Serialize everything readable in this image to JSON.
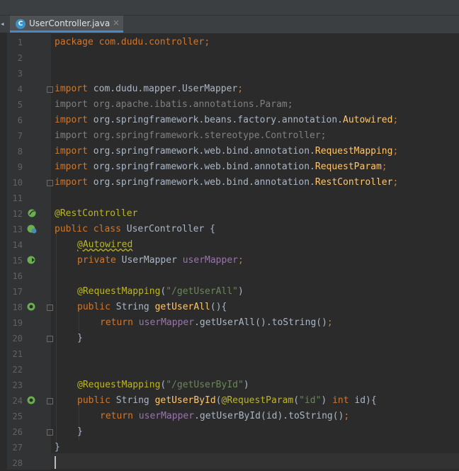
{
  "tab": {
    "icon_letter": "C",
    "label": "UserController.java",
    "close_symbol": "×",
    "left_arrow": "◂"
  },
  "line_numbers": [
    "1",
    "2",
    "3",
    "4",
    "5",
    "6",
    "7",
    "8",
    "9",
    "10",
    "11",
    "12",
    "13",
    "14",
    "15",
    "16",
    "17",
    "18",
    "19",
    "20",
    "21",
    "22",
    "23",
    "24",
    "25",
    "26",
    "27",
    "28"
  ],
  "gutter_icons": {
    "bean": "spring-bean-icon",
    "autowired": "autowired-navigate-icon",
    "mapping": "request-mapping-icon",
    "fold": "fold-marker-icon"
  },
  "code": {
    "l1": {
      "kw": "package",
      "rest": " com.dudu.controller;"
    },
    "l4": {
      "kw": "import",
      "rest": " com.dudu.mapper.UserMapper",
      "semi": ";"
    },
    "l5": {
      "text": "import org.apache.ibatis.annotations.Param;"
    },
    "l6": {
      "kw": "import",
      "rest": " org.springframework.beans.factory.annotation.",
      "ann": "Autowired",
      "semi": ";"
    },
    "l7": {
      "text": "import org.springframework.stereotype.Controller;"
    },
    "l8": {
      "kw": "import",
      "rest": " org.springframework.web.bind.annotation.",
      "ann": "RequestMapping",
      "semi": ";"
    },
    "l9": {
      "kw": "import",
      "rest": " org.springframework.web.bind.annotation.",
      "ann": "RequestParam",
      "semi": ";"
    },
    "l10": {
      "kw": "import",
      "rest": " org.springframework.web.bind.annotation.",
      "ann": "RestController",
      "semi": ";"
    },
    "l12": {
      "ann": "@RestController"
    },
    "l13": {
      "kw": "public class",
      "rest": " UserController {"
    },
    "l14": {
      "ann": "@Autowired"
    },
    "l15": {
      "kw": "private",
      "type": " UserMapper ",
      "fld": "userMapper",
      "semi": ";"
    },
    "l17": {
      "ann": "@RequestMapping",
      "p1": "(",
      "str": "\"/getUserAll\"",
      "p2": ")"
    },
    "l18": {
      "kw": "public",
      "type": " String ",
      "fn": "getUserAll",
      "rest": "(){"
    },
    "l19": {
      "kw": "return",
      "sp": " ",
      "fld": "userMapper",
      "rest": ".getUserAll().toString()",
      "semi": ";"
    },
    "l20": {
      "text": "}"
    },
    "l23": {
      "ann": "@RequestMapping",
      "p1": "(",
      "str": "\"/getUserById\"",
      "p2": ")"
    },
    "l24": {
      "kw": "public",
      "type": " String ",
      "fn": "getUserById",
      "p1": "(",
      "ann": "@RequestParam",
      "p2": "(",
      "str": "\"id\"",
      "p3": ") ",
      "kw2": "int",
      "rest": " id){"
    },
    "l25": {
      "kw": "return",
      "sp": " ",
      "fld": "userMapper",
      "rest": ".getUserById(id).toString()",
      "semi": ";"
    },
    "l26": {
      "text": "}"
    },
    "l27": {
      "text": "}"
    }
  },
  "colors": {
    "background": "#2b2b2b",
    "gutter": "#313335",
    "keyword": "#cc7832",
    "annotation": "#bbb529",
    "string": "#6a8759",
    "field": "#9876aa",
    "method": "#ffc66d",
    "text": "#a9b7c6",
    "unused_import": "#808080",
    "tab_underline": "#4a88c7"
  }
}
